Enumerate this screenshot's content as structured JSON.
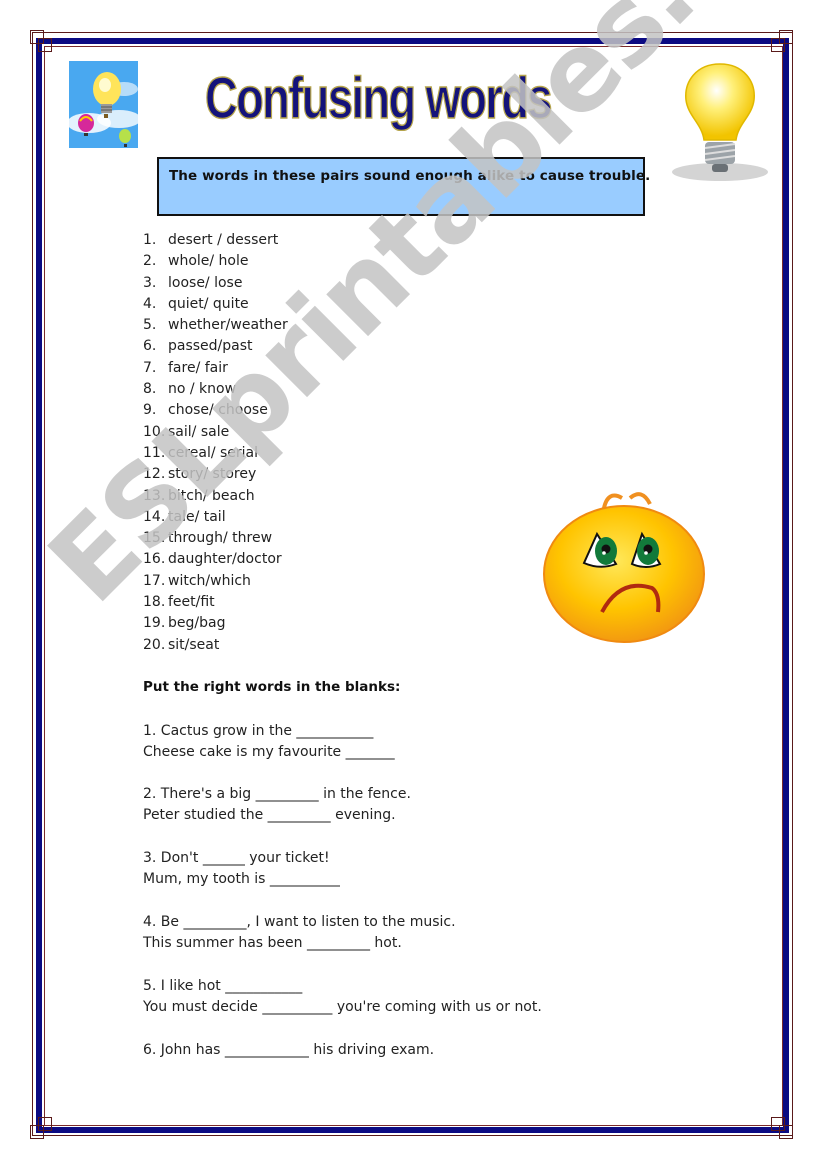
{
  "page": {
    "title": "Confusing words",
    "subtitle": "The words in these pairs sound enough alike to cause trouble.",
    "watermark": "ESLprintables.com",
    "colors": {
      "title": "#14137a",
      "subtitle_box": "#99ccff",
      "border_navy": "#0b0a82",
      "border_red": "#5a1a1a",
      "watermark": "#c4c4c4"
    }
  },
  "images": {
    "top_left": "lightbulb-with-hot-air-balloons-in-sky",
    "top_right": "glowing-lightbulb",
    "right_middle": "sad-worried-smiley-face"
  },
  "word_pairs": [
    {
      "n": "1.",
      "text": "desert / dessert"
    },
    {
      "n": "2.",
      "text": "whole/ hole"
    },
    {
      "n": "3.",
      "text": "loose/ lose"
    },
    {
      "n": "4.",
      "text": "quiet/ quite"
    },
    {
      "n": "5.",
      "text": "whether/weather"
    },
    {
      "n": "6.",
      "text": "passed/past"
    },
    {
      "n": "7.",
      "text": "fare/ fair"
    },
    {
      "n": "8.",
      "text": "no / know"
    },
    {
      "n": "9.",
      "text": "chose/ choose"
    },
    {
      "n": "10.",
      "text": "sail/ sale"
    },
    {
      "n": "11.",
      "text": "cereal/ serial"
    },
    {
      "n": "12.",
      "text": "story/ storey"
    },
    {
      "n": "13.",
      "text": "bitch/ beach"
    },
    {
      "n": "14.",
      "text": "tale/ tail"
    },
    {
      "n": "15.",
      "text": "through/ threw"
    },
    {
      "n": "16.",
      "text": "daughter/doctor"
    },
    {
      "n": "17.",
      "text": "witch/which"
    },
    {
      "n": "18.",
      "text": "feet/fit"
    },
    {
      "n": "19.",
      "text": "beg/bag"
    },
    {
      "n": "20.",
      "text": "sit/seat"
    }
  ],
  "instruction": "Put the right words in the blanks:",
  "exercises": [
    {
      "line1": "1.   Cactus grow in the ___________",
      "line2": "Cheese cake is my favourite _______"
    },
    {
      "line1": "2.   There's a big _________ in the fence.",
      "line2": "Peter studied the _________ evening."
    },
    {
      "line1": "3.   Don't ______ your ticket!",
      "line2": "Mum, my tooth is __________"
    },
    {
      "line1": "4.   Be _________, I want to listen to the music.",
      "line2": "This summer has been _________ hot."
    },
    {
      "line1": "5.   I like hot ___________",
      "line2": "You must decide __________ you're coming with us or not."
    },
    {
      "line1": "6.   John has ____________ his driving exam.",
      "line2": ""
    }
  ]
}
